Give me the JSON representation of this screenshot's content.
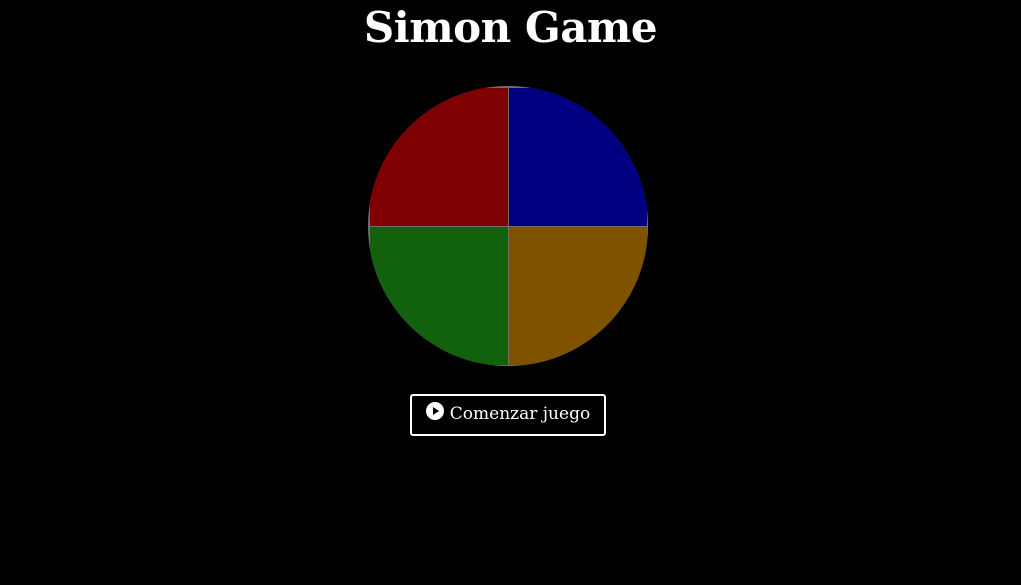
{
  "header": {
    "title": "Simon Game"
  },
  "board": {
    "pads": [
      {
        "name": "red",
        "color": "#7f0000"
      },
      {
        "name": "blue",
        "color": "#000080"
      },
      {
        "name": "green",
        "color": "#11610d"
      },
      {
        "name": "yellow",
        "color": "#7f5200"
      }
    ],
    "border_color": "#6e6e6e"
  },
  "controls": {
    "start_label": "Comenzar juego",
    "start_icon": "play-circle-icon"
  },
  "colors": {
    "background": "#000000",
    "text": "#ffffff"
  }
}
